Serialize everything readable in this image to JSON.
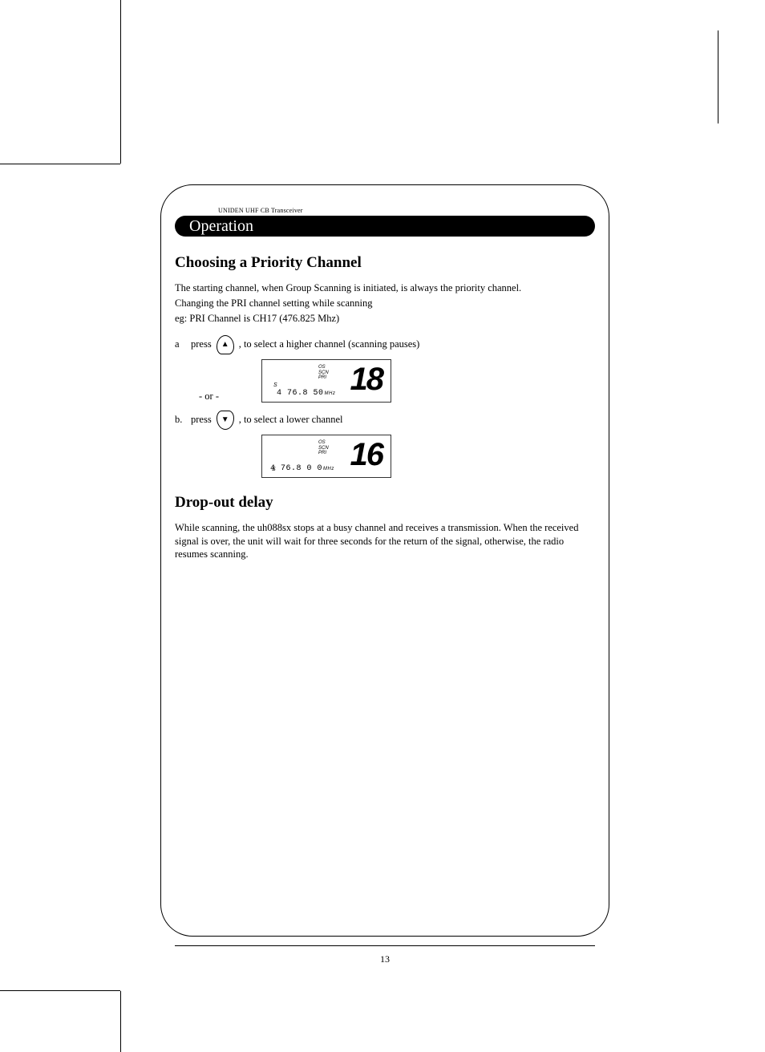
{
  "meta": {
    "tiny_header": "UNIDEN UHF CB Transceiver",
    "pill_title": "Operation",
    "page_number": "13"
  },
  "section1": {
    "title": "Choosing a Priority Channel",
    "para1": "The starting channel, when Group Scanning is initiated, is always the priority channel.",
    "para2": "Changing the PRI channel setting while scanning",
    "para3": "eg:  PRI Channel is CH17 (476.825 Mhz)",
    "step_a_label": "a",
    "press_word": "press",
    "step_a_text": ", to select a higher channel (scanning pauses)",
    "or_text": "- or -",
    "step_b_label": "b.",
    "step_b_text": ", to select a lower channel"
  },
  "lcd1": {
    "ind1": "OS",
    "ind2": "SCN",
    "ind3": "PRI",
    "s": "S",
    "freq": "4 76.8 50",
    "mhz": "MHz",
    "channel": "18"
  },
  "lcd2": {
    "ind1": "OS",
    "ind2": "SCN",
    "ind3": "PRI",
    "s": "S",
    "freq": "4 76.8 0 0",
    "mhz": "MHz",
    "channel": "16"
  },
  "section2": {
    "title": "Drop-out delay",
    "para": "While scanning, the uh088sx stops at a busy channel and receives a transmission.  When the received signal is over, the unit will wait for three seconds for the return of the signal, otherwise, the radio resumes scanning."
  },
  "icons": {
    "up": "▲",
    "down": "▼"
  }
}
